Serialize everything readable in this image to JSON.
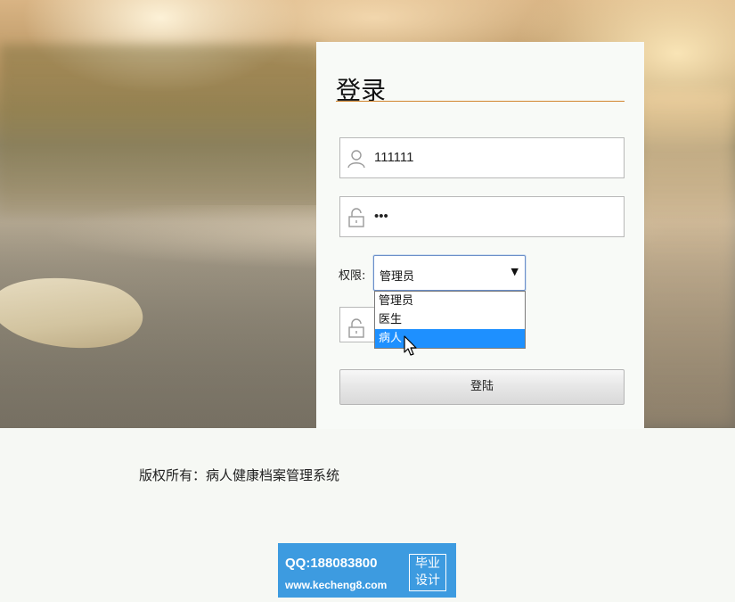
{
  "login": {
    "title": "登录",
    "username_value": "111111",
    "password_value": "•••",
    "role_label": "权限:",
    "role_selected": "管理员",
    "role_options": [
      "管理员",
      "医生",
      "病人"
    ],
    "highlighted_option": "病人",
    "submit_label": "登陆"
  },
  "footer": {
    "copyright": "版权所有：病人健康档案管理系统"
  },
  "watermark": {
    "qq_line": "QQ:188083800",
    "site_line": "www.kecheng8.com",
    "box_line1": "毕业",
    "box_line2": "设计"
  },
  "icons": {
    "username": "user-icon",
    "password": "lock-icon",
    "verify": "lock-icon",
    "select": "caret-down-icon",
    "pointer": "mouse-cursor-icon"
  },
  "colors": {
    "title_rule": "#d2852f",
    "option_highlight": "#1e90ff",
    "select_border": "#6b8fc9",
    "banner": "#3d9be0"
  }
}
